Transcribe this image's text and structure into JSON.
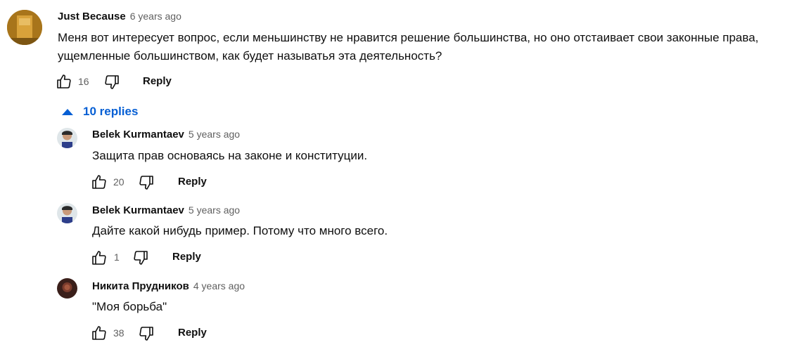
{
  "comment": {
    "author": "Just Because",
    "time": "6 years ago",
    "text_line1": "Меня вот интересует вопрос, если меньшинству не нравится решение большинства, но оно отстаивает свои законные права,",
    "text_line2": "ущемленные большинством, как будет называтья эта деятельность?",
    "likes": "16",
    "reply_label": "Reply"
  },
  "replies_toggle": {
    "label": "10 replies"
  },
  "replies": [
    {
      "author": "Belek Kurmantaev",
      "time": "5 years ago",
      "text": "Защита прав основаясь на законе и конституции.",
      "likes": "20",
      "reply_label": "Reply"
    },
    {
      "author": "Belek Kurmantaev",
      "time": "5 years ago",
      "text": "Дайте какой нибудь пример. Потому что много всего.",
      "likes": "1",
      "reply_label": "Reply"
    },
    {
      "author": "Никита Прудников",
      "time": "4 years ago",
      "text": "\"Моя борьба\"",
      "likes": "38",
      "reply_label": "Reply"
    }
  ],
  "icons": {
    "like": "thumb-up-icon",
    "dislike": "thumb-down-icon",
    "collapse": "caret-up-icon"
  },
  "colors": {
    "link_blue": "#065fd4",
    "secondary_text": "#606060",
    "primary_text": "#0f0f0f"
  }
}
